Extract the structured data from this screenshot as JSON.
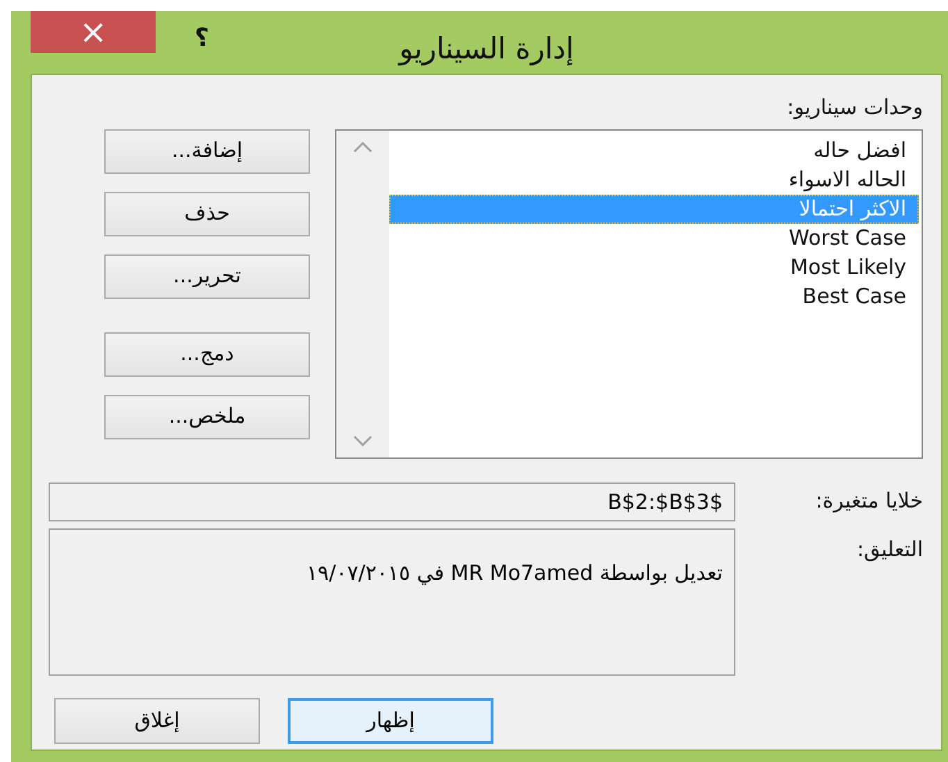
{
  "window": {
    "title": "إدارة السيناريو",
    "help": "؟",
    "close": "×"
  },
  "scenarios": {
    "label": "وحدات سيناريو:",
    "items": [
      {
        "name": "افضل حاله",
        "selected": false
      },
      {
        "name": "الحاله الاسواء",
        "selected": false
      },
      {
        "name": "الاكثر احتمالا",
        "selected": true
      },
      {
        "name": "Worst Case",
        "selected": false
      },
      {
        "name": "Most Likely",
        "selected": false
      },
      {
        "name": "Best Case",
        "selected": false
      }
    ]
  },
  "side_buttons": [
    [
      "إضافة...",
      "حذف",
      "تحرير..."
    ],
    [
      "دمج...",
      "ملخص..."
    ]
  ],
  "changing_cells": {
    "label": "خلايا متغيرة:",
    "value": "$B$2:$B$3"
  },
  "comment": {
    "label": "التعليق:",
    "value": "تعديل بواسطة MR Mo7amed في ١٩/٠٧/٢٠١٥"
  },
  "footer_buttons": [
    {
      "label": "إظهار",
      "focused": true
    },
    {
      "label": "إغلاق",
      "focused": false
    }
  ]
}
